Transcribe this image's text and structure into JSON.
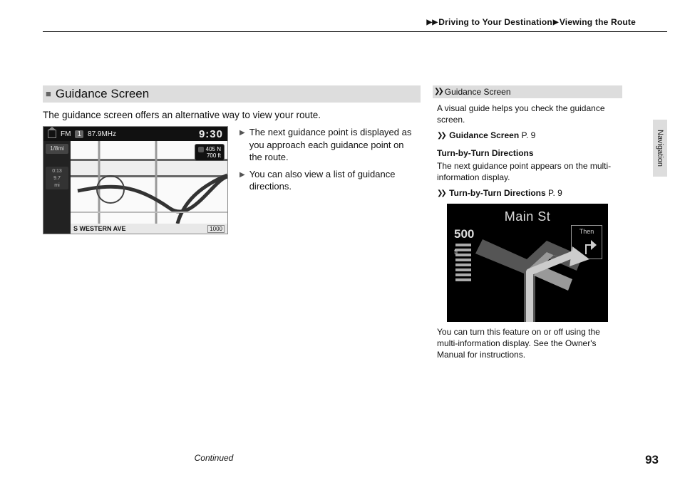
{
  "breadcrumb": {
    "part1": "Driving to Your Destination",
    "part2": "Viewing the Route"
  },
  "sideTab": "Navigation",
  "main": {
    "heading": "Guidance Screen",
    "intro": "The guidance screen offers an alternative way to view your route.",
    "bullets": [
      "The next guidance point is displayed as you approach each guidance point on the route.",
      "You can also view a list of guidance directions."
    ],
    "mapShot": {
      "fmLabel": "FM",
      "fmCh": "1",
      "fmFreq": "87.9MHz",
      "clock": "9:30",
      "leftChip": "1/8mi",
      "leftBox1": "0:13",
      "leftBox2": "9.7",
      "leftBox3": "mi",
      "sign1": "405 N",
      "sign2": "700 ft",
      "street": "S WESTERN AVE",
      "scale": "1000"
    }
  },
  "sidebar": {
    "heading": "Guidance Screen",
    "p1": "A visual guide helps you check the guidance screen.",
    "xref1_label": "Guidance Screen",
    "xref1_page": "P. 9",
    "sub_h": "Turn-by-Turn Directions",
    "p2": "The next guidance point appears on the multi-information display.",
    "xref2_label": "Turn-by-Turn Directions",
    "xref2_page": "P. 9",
    "turnShot": {
      "street": "Main St",
      "dist_num": "500",
      "dist_unit": "ft",
      "then_label": "Then"
    },
    "p3": "You can turn this feature on or off using the multi-information display. See the Owner's Manual for instructions."
  },
  "footer": {
    "continued": "Continued",
    "pageNum": "93"
  }
}
